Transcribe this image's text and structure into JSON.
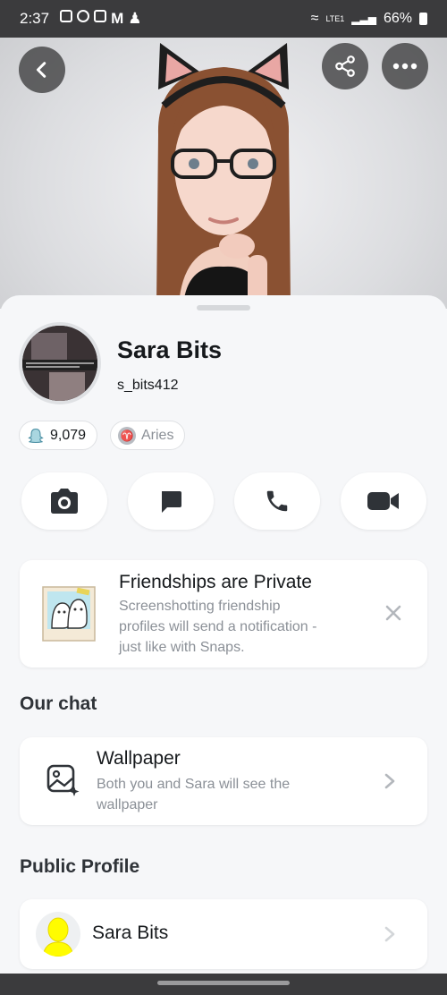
{
  "status_bar": {
    "time": "2:37",
    "battery": "66%",
    "network": "LTE1"
  },
  "header": {
    "back_icon": "chevron-left-icon",
    "share_icon": "share-icon",
    "more_icon": "more-horizontal-icon"
  },
  "profile": {
    "name": "Sara Bits",
    "username": "s_bits412",
    "snap_score": "9,079",
    "zodiac": "Aries"
  },
  "actions": [
    {
      "icon": "camera-icon"
    },
    {
      "icon": "chat-icon"
    },
    {
      "icon": "phone-icon"
    },
    {
      "icon": "video-icon"
    }
  ],
  "privacy_card": {
    "title": "Friendships are Private",
    "subtitle_lines": [
      "Screenshotting friendship",
      "profiles will send a notification -",
      "just like with Snaps."
    ]
  },
  "our_chat": {
    "heading": "Our chat",
    "wallpaper_title": "Wallpaper",
    "wallpaper_sub_lines": [
      "Both you and Sara will see the",
      "wallpaper"
    ]
  },
  "public_profile": {
    "heading": "Public Profile",
    "name": "Sara Bits"
  },
  "colors": {
    "accent_yellow": "#fffc00",
    "text_primary": "#16191c",
    "text_secondary": "#8b9097"
  }
}
